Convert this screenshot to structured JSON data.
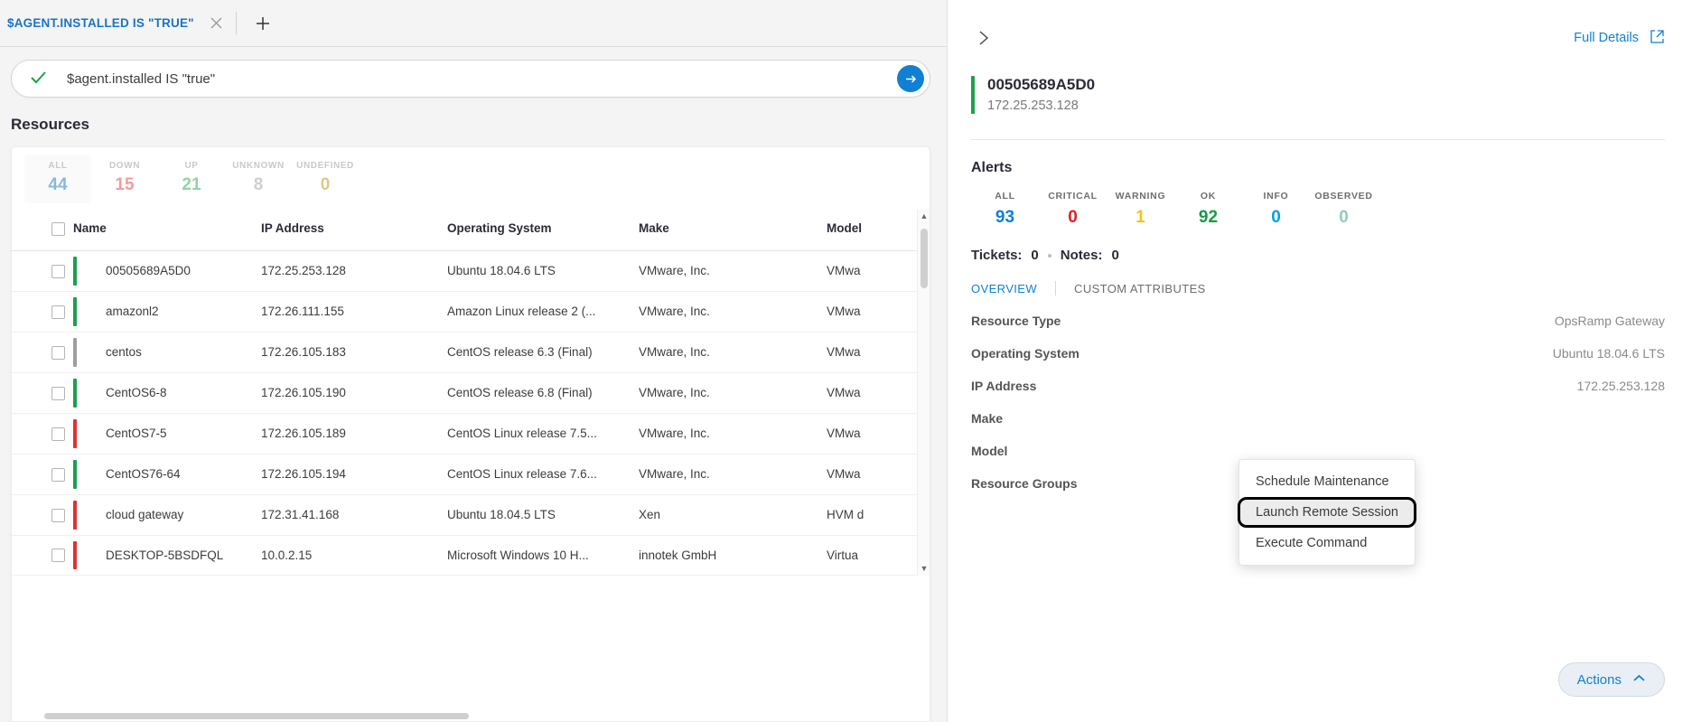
{
  "tab": {
    "label": "$AGENT.INSTALLED IS \"TRUE\"",
    "close_icon": "close-icon",
    "add_icon": "plus-icon"
  },
  "query": {
    "check_icon": "check-icon",
    "value": "$agent.installed IS \"true\"",
    "submit_icon": "arrow-right-icon"
  },
  "resources": {
    "title": "Resources",
    "chips": [
      {
        "label": "ALL",
        "value": "44",
        "color": "#8ab8dd",
        "active": true
      },
      {
        "label": "DOWN",
        "value": "15",
        "color": "#f29b9b",
        "active": false
      },
      {
        "label": "UP",
        "value": "21",
        "color": "#8fd4a4",
        "active": false
      },
      {
        "label": "UNKNOWN",
        "value": "8",
        "color": "#cfcfcf",
        "active": false
      },
      {
        "label": "UNDEFINED",
        "value": "0",
        "color": "#ddc98a",
        "active": false
      }
    ],
    "columns": [
      "Name",
      "IP Address",
      "Operating System",
      "Make",
      "Model"
    ],
    "rows": [
      {
        "status": "#1aa04b",
        "name": "00505689A5D0",
        "ip": "172.25.253.128",
        "os": "Ubuntu 18.04.6 LTS",
        "make": "VMware, Inc.",
        "model": "VMwa"
      },
      {
        "status": "#1aa04b",
        "name": "amazonl2",
        "ip": "172.26.111.155",
        "os": "Amazon Linux release 2 (...",
        "make": "VMware, Inc.",
        "model": "VMwa"
      },
      {
        "status": "#9e9e9e",
        "name": "centos",
        "ip": "172.26.105.183",
        "os": "CentOS release 6.3 (Final)",
        "make": "VMware, Inc.",
        "model": "VMwa"
      },
      {
        "status": "#1aa04b",
        "name": "CentOS6-8",
        "ip": "172.26.105.190",
        "os": "CentOS release 6.8 (Final)",
        "make": "VMware, Inc.",
        "model": "VMwa"
      },
      {
        "status": "#e03131",
        "name": "CentOS7-5",
        "ip": "172.26.105.189",
        "os": "CentOS Linux release 7.5...",
        "make": "VMware, Inc.",
        "model": "VMwa"
      },
      {
        "status": "#1aa04b",
        "name": "CentOS76-64",
        "ip": "172.26.105.194",
        "os": "CentOS Linux release 7.6...",
        "make": "VMware, Inc.",
        "model": "VMwa"
      },
      {
        "status": "#e03131",
        "name": "cloud gateway",
        "ip": "172.31.41.168",
        "os": "Ubuntu 18.04.5 LTS",
        "make": "Xen",
        "model": "HVM d"
      },
      {
        "status": "#e03131",
        "name": "DESKTOP-5BSDFQL",
        "ip": "10.0.2.15",
        "os": "Microsoft Windows 10 H...",
        "make": "innotek GmbH",
        "model": "Virtua"
      }
    ]
  },
  "details": {
    "collapse_icon": "chevron-right-icon",
    "full_details_label": "Full Details",
    "external_icon": "external-link-icon",
    "resource_name": "00505689A5D0",
    "resource_ip": "172.25.253.128",
    "alerts_title": "Alerts",
    "alerts": [
      {
        "label": "ALL",
        "value": "93",
        "color": "#1180d4"
      },
      {
        "label": "CRITICAL",
        "value": "0",
        "color": "#e02020"
      },
      {
        "label": "WARNING",
        "value": "1",
        "color": "#f5c518"
      },
      {
        "label": "OK",
        "value": "92",
        "color": "#169b45"
      },
      {
        "label": "INFO",
        "value": "0",
        "color": "#00a3e0"
      },
      {
        "label": "OBSERVED",
        "value": "0",
        "color": "#8ecec0"
      }
    ],
    "tickets_label": "Tickets:",
    "tickets_value": "0",
    "notes_label": "Notes:",
    "notes_value": "0",
    "tabs": [
      {
        "label": "OVERVIEW",
        "active": true
      },
      {
        "label": "CUSTOM ATTRIBUTES",
        "active": false
      }
    ],
    "fields": [
      {
        "key": "Resource Type",
        "value": "OpsRamp Gateway"
      },
      {
        "key": "Operating System",
        "value": "Ubuntu 18.04.6 LTS"
      },
      {
        "key": "IP Address",
        "value": "172.25.253.128"
      },
      {
        "key": "Make",
        "value": ""
      },
      {
        "key": "Model",
        "value": ""
      },
      {
        "key": "Resource Groups",
        "value": ""
      }
    ],
    "context_menu": [
      {
        "label": "Schedule Maintenance",
        "highlighted": false
      },
      {
        "label": "Launch Remote Session",
        "highlighted": true
      },
      {
        "label": "Execute Command",
        "highlighted": false
      }
    ],
    "actions_label": "Actions",
    "actions_icon": "chevron-up-icon"
  }
}
